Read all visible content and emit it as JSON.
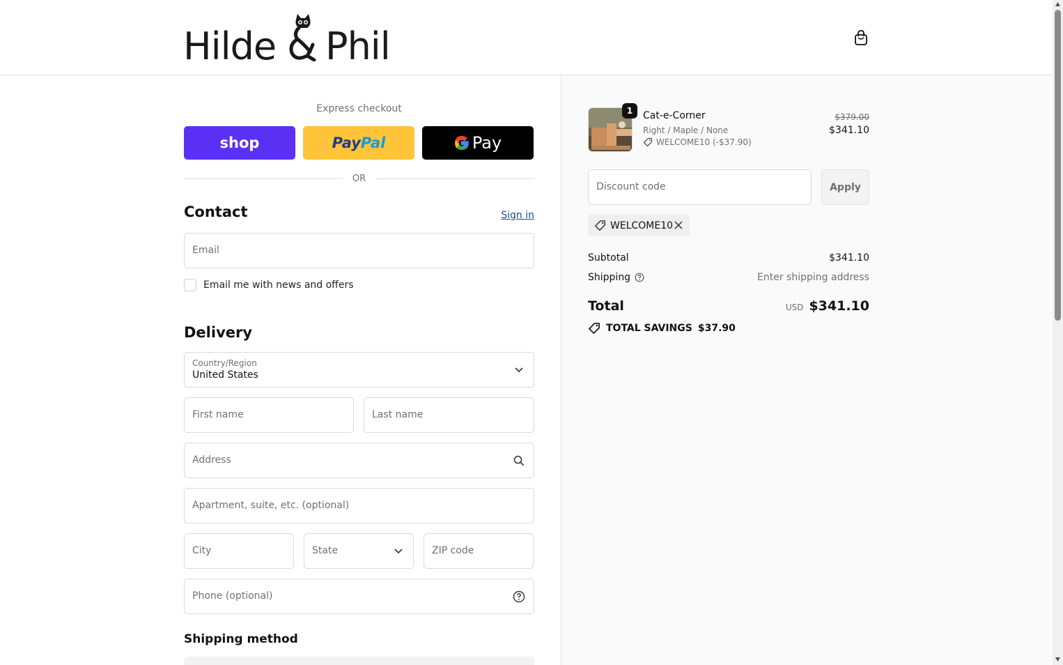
{
  "brand": {
    "left": "Hilde",
    "right": "Phil",
    "amp": "&"
  },
  "express": {
    "title": "Express checkout",
    "shop_label": "shop",
    "paypal_label_1": "Pay",
    "paypal_label_2": "Pal",
    "gpay_label": "Pay",
    "or_label": "OR"
  },
  "contact": {
    "title": "Contact",
    "signin_label": "Sign in",
    "email_placeholder": "Email",
    "newsletter_label": "Email me with news and offers"
  },
  "delivery": {
    "title": "Delivery",
    "country_label": "Country/Region",
    "country_value": "United States",
    "first_name_placeholder": "First name",
    "last_name_placeholder": "Last name",
    "address_placeholder": "Address",
    "apartment_placeholder": "Apartment, suite, etc. (optional)",
    "city_placeholder": "City",
    "state_placeholder": "State",
    "zip_placeholder": "ZIP code",
    "phone_placeholder": "Phone (optional)"
  },
  "shipping_method": {
    "title": "Shipping method"
  },
  "order": {
    "item": {
      "quantity": "1",
      "name": "Cat-e-Corner",
      "variant": "Right / Maple / None",
      "discount": "WELCOME10 (-$37.90)",
      "price_original": "$379.00",
      "price_final": "$341.10"
    },
    "discount_placeholder": "Discount code",
    "apply_label": "Apply",
    "applied_code": "WELCOME10",
    "subtotal_label": "Subtotal",
    "subtotal_value": "$341.10",
    "shipping_label": "Shipping",
    "shipping_value": "Enter shipping address",
    "total_label": "Total",
    "total_currency": "USD",
    "total_value": "$341.10",
    "savings_label": "TOTAL SAVINGS",
    "savings_value": "$37.90"
  }
}
